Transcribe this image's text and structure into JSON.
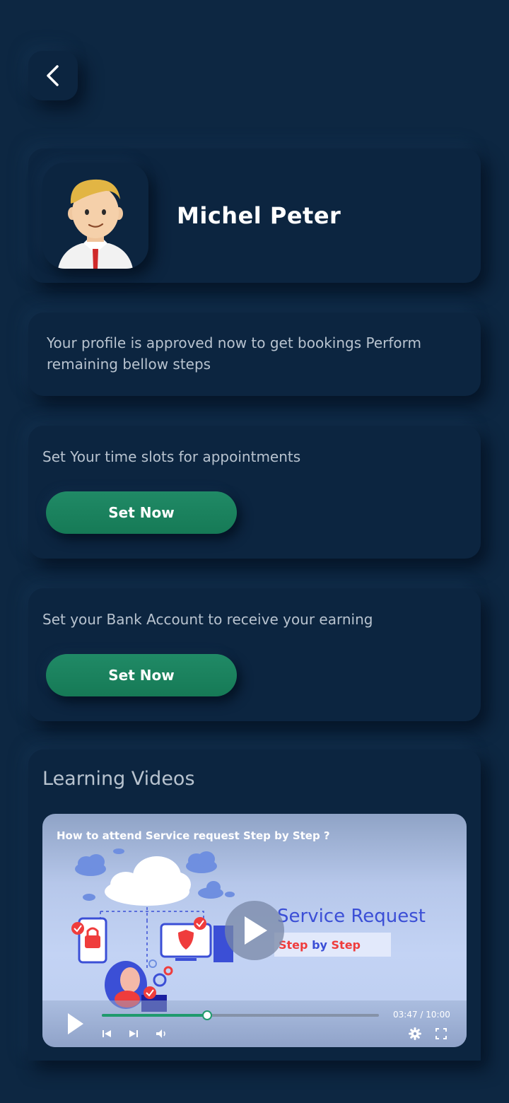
{
  "profile": {
    "name": "Michel Peter"
  },
  "approval": {
    "message": "Your profile is approved now to get bookings Perform remaining bellow steps"
  },
  "tasks": [
    {
      "text": "Set Your time slots for appointments",
      "button": "Set Now"
    },
    {
      "text": "Set your Bank Account to receive your earning",
      "button": "Set Now"
    }
  ],
  "learning": {
    "heading": "Learning Videos",
    "video": {
      "title": "How to attend Service request Step by Step ?",
      "thumbnail_heading": "Service Request",
      "thumbnail_sub_step1": "Step",
      "thumbnail_sub_by": "by",
      "thumbnail_sub_step2": "Step",
      "time": "03:47 / 10:00",
      "progress": 0.379
    }
  },
  "colors": {
    "background": "#0d2742",
    "card": "#0c2540",
    "accent": "#1a8460",
    "muted_text": "#b8c3cf"
  },
  "icons": [
    "back-icon",
    "play-icon",
    "skip-back-icon",
    "skip-forward-icon",
    "volume-icon",
    "settings-icon",
    "fullscreen-icon"
  ]
}
